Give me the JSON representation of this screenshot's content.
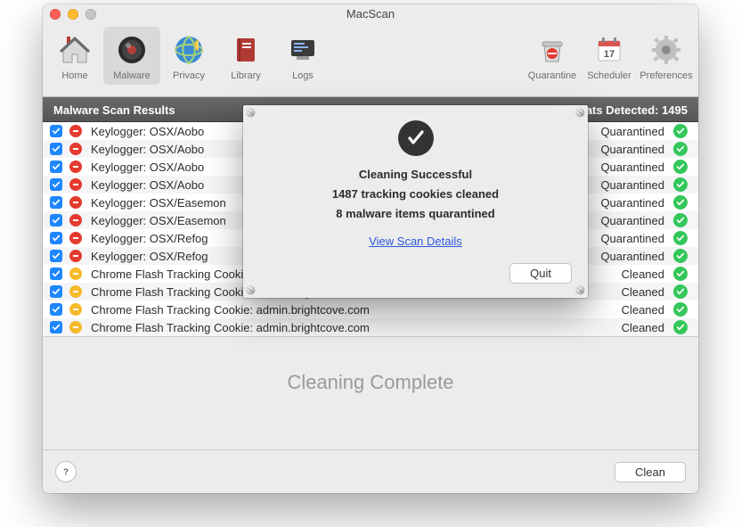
{
  "title": "MacScan",
  "toolbar": {
    "left": [
      {
        "id": "home",
        "label": "Home"
      },
      {
        "id": "malware",
        "label": "Malware"
      },
      {
        "id": "privacy",
        "label": "Privacy"
      },
      {
        "id": "library",
        "label": "Library"
      },
      {
        "id": "logs",
        "label": "Logs"
      }
    ],
    "right": [
      {
        "id": "quarantine",
        "label": "Quarantine"
      },
      {
        "id": "scheduler",
        "label": "Scheduler"
      },
      {
        "id": "preferences",
        "label": "Preferences"
      }
    ],
    "selected": "malware"
  },
  "header": {
    "left": "Malware Scan Results",
    "right": "Threats Detected: 1495"
  },
  "rows": [
    {
      "sev": "red",
      "name": "Keylogger: OSX/Aobo",
      "status": "Quarantined"
    },
    {
      "sev": "red",
      "name": "Keylogger: OSX/Aobo",
      "status": "Quarantined"
    },
    {
      "sev": "red",
      "name": "Keylogger: OSX/Aobo",
      "status": "Quarantined"
    },
    {
      "sev": "red",
      "name": "Keylogger: OSX/Aobo",
      "status": "Quarantined"
    },
    {
      "sev": "red",
      "name": "Keylogger: OSX/Easemon",
      "status": "Quarantined"
    },
    {
      "sev": "red",
      "name": "Keylogger: OSX/Easemon",
      "status": "Quarantined"
    },
    {
      "sev": "red",
      "name": "Keylogger: OSX/Refog",
      "status": "Quarantined"
    },
    {
      "sev": "red",
      "name": "Keylogger: OSX/Refog",
      "status": "Quarantined"
    },
    {
      "sev": "yel",
      "name": "Chrome Flash Tracking Cookie: admin.brightcove.com",
      "status": "Cleaned"
    },
    {
      "sev": "yel",
      "name": "Chrome Flash Tracking Cookie: admin.brightcove.com",
      "status": "Cleaned"
    },
    {
      "sev": "yel",
      "name": "Chrome Flash Tracking Cookie: admin.brightcove.com",
      "status": "Cleaned"
    },
    {
      "sev": "yel",
      "name": "Chrome Flash Tracking Cookie: admin.brightcove.com",
      "status": "Cleaned"
    }
  ],
  "complete_text": "Cleaning Complete",
  "footer": {
    "clean": "Clean"
  },
  "dialog": {
    "title": "Cleaning Successful",
    "line1": "1487 tracking cookies cleaned",
    "line2": "8 malware items quarantined",
    "link": "View Scan Details",
    "quit": "Quit"
  }
}
